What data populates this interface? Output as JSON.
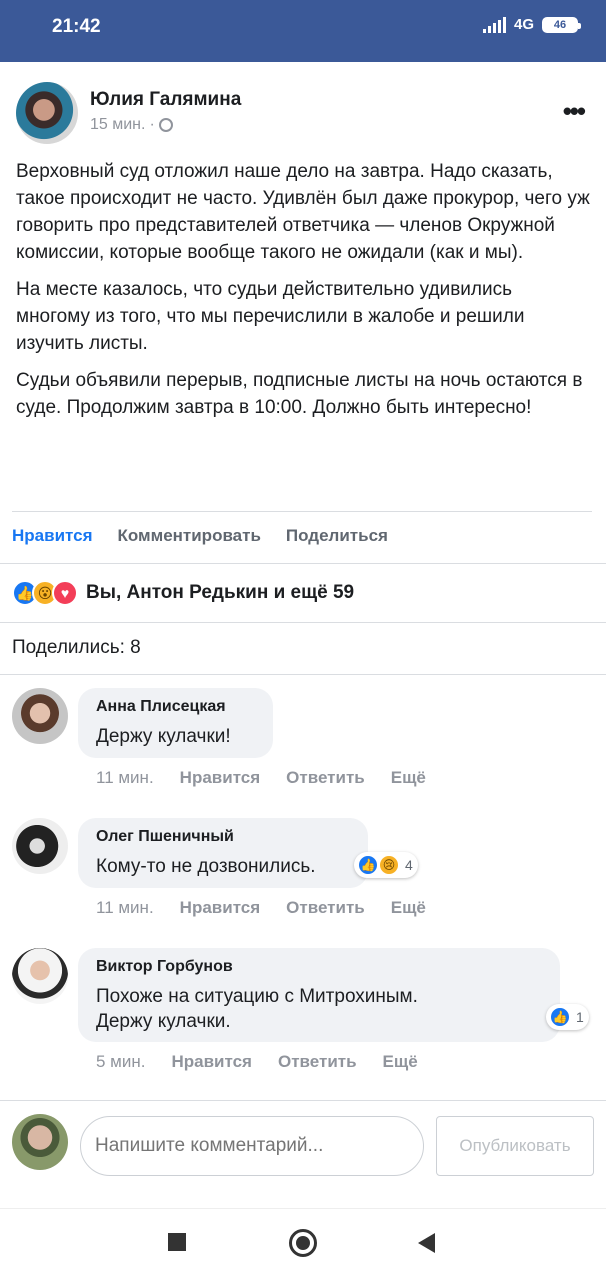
{
  "status_bar": {
    "time": "21:42",
    "network": "4G",
    "battery": "46"
  },
  "post": {
    "author": "Юлия Галямина",
    "time": "15 мин.",
    "separator": "·",
    "paragraphs": [
      "Верховный суд отложил наше дело на завтра. Надо сказать, такое происходит не часто. Удивлён был даже прокурор, чего уж говорить про представителей ответчика — членов Окружной комиссии, которые вообще такого не ожидали (как и мы).",
      "На месте казалось, что судьи действительно удивились многому из того, что мы перечислили в жалобе и решили изучить листы.",
      "Судьи объявили перерыв, подписные листы на ночь остаются в суде. Продолжим завтра в 10:00. Должно быть интересно!"
    ]
  },
  "actions": {
    "like": "Нравится",
    "comment": "Комментировать",
    "share": "Поделиться"
  },
  "reactions_summary": "Вы, Антон Редькин и ещё 59",
  "shares_count": "Поделились: 8",
  "comments": [
    {
      "name": "Анна Плисецкая",
      "text": "Держу кулачки!",
      "time": "11 мин.",
      "like": "Нравится",
      "reply": "Ответить",
      "more": "Ещё"
    },
    {
      "name": "Олег Пшеничный",
      "text": "Кому-то не дозвонились.",
      "time": "11 мин.",
      "like": "Нравится",
      "reply": "Ответить",
      "more": "Ещё",
      "reaction_count": "4"
    },
    {
      "name": "Виктор Горбунов",
      "text_line1": "Похоже на ситуацию с Митрохиным.",
      "text_line2": "Держу кулачки.",
      "time": "5 мин.",
      "like": "Нравится",
      "reply": "Ответить",
      "more": "Ещё",
      "reaction_count": "1"
    }
  ],
  "composer": {
    "placeholder": "Напишите комментарий...",
    "publish": "Опубликовать"
  },
  "colors": {
    "header": "#3b5998",
    "like_active": "#1877f2",
    "meta": "#90949c"
  }
}
